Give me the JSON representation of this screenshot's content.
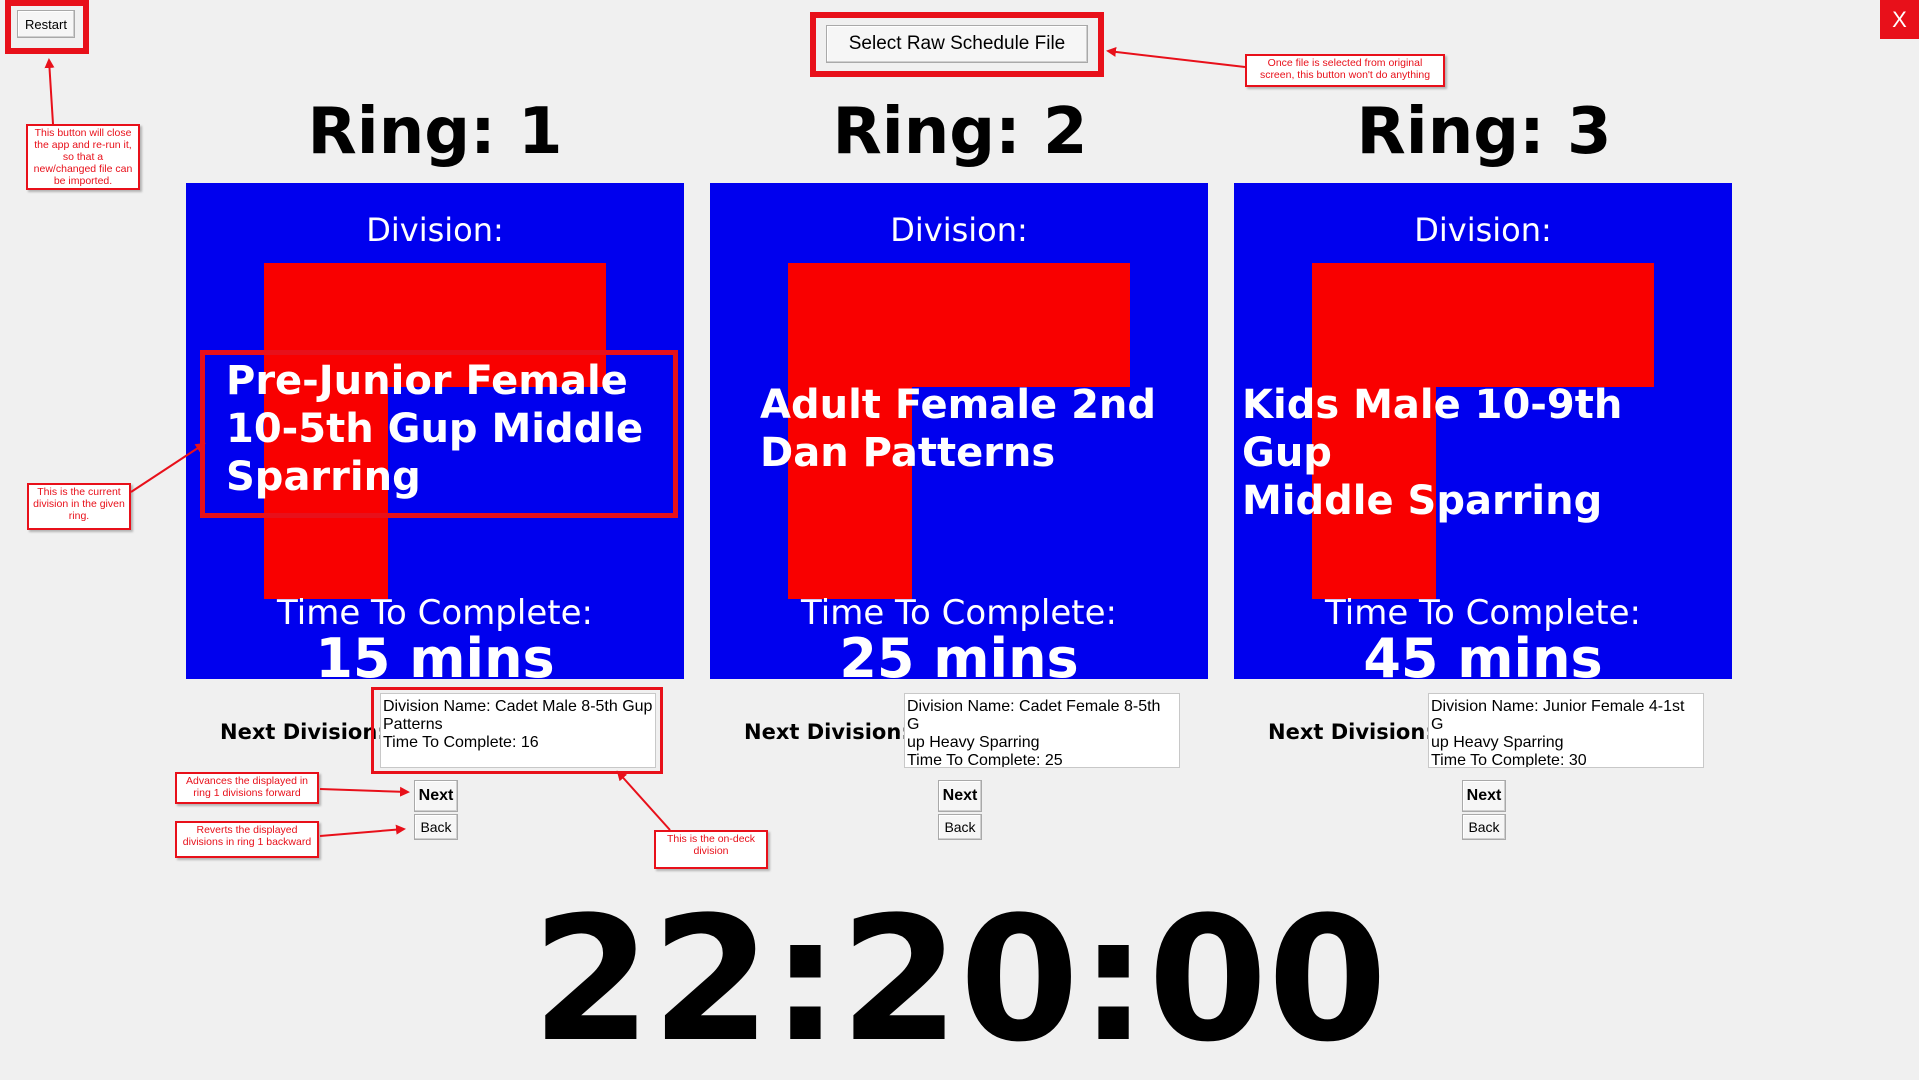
{
  "window": {
    "restart_label": "Restart",
    "select_file_label": "Select Raw Schedule File",
    "close_label": "X"
  },
  "rings": [
    {
      "title": "Ring: 1",
      "division_label": "Division:",
      "division_name_lines": [
        "Pre-Junior Female",
        "10-5th Gup Middle",
        "Sparring"
      ],
      "time_label": "Time To Complete:",
      "time_value": "15 mins",
      "next_label": "Next Division:",
      "next_lines": [
        "Division Name: Cadet Male 8-5th Gup",
        "Patterns",
        "Time To Complete: 16"
      ],
      "next_button": "Next",
      "back_button": "Back"
    },
    {
      "title": "Ring: 2",
      "division_label": "Division:",
      "division_name_lines": [
        "Adult Female 2nd",
        "Dan Patterns"
      ],
      "time_label": "Time To Complete:",
      "time_value": "25 mins",
      "next_label": "Next Division:",
      "next_lines": [
        "Division Name: Cadet Female 8-5th G",
        "up Heavy Sparring",
        "Time To Complete: 25"
      ],
      "next_button": "Next",
      "back_button": "Back"
    },
    {
      "title": "Ring: 3",
      "division_label": "Division:",
      "division_name_lines": [
        "Kids Male 10-9th Gup",
        "Middle Sparring"
      ],
      "time_label": "Time To Complete:",
      "time_value": "45 mins",
      "next_label": "Next Division:",
      "next_lines": [
        "Division Name: Junior Female 4-1st G",
        "up Heavy Sparring",
        "Time To Complete: 30"
      ],
      "next_button": "Next",
      "back_button": "Back"
    }
  ],
  "clock": "22:20:00",
  "annotations": {
    "restart_note": "This button will close the app and re-run it, so that a new/changed file can be imported.",
    "select_file_note": "Once file is selected from original screen, this button won't do anything",
    "current_division_note": "This is the current division in the given ring.",
    "next_note": "Advances the displayed in ring 1 divisions forward",
    "back_note": "Reverts the displayed divisions in ring 1 backward",
    "on_deck_note": "This is the on-deck division"
  },
  "colors": {
    "panel_blue": "#0000ee",
    "ring_red": "#f90000",
    "annotation_red": "#e8101a",
    "background": "#f0f0f0"
  }
}
